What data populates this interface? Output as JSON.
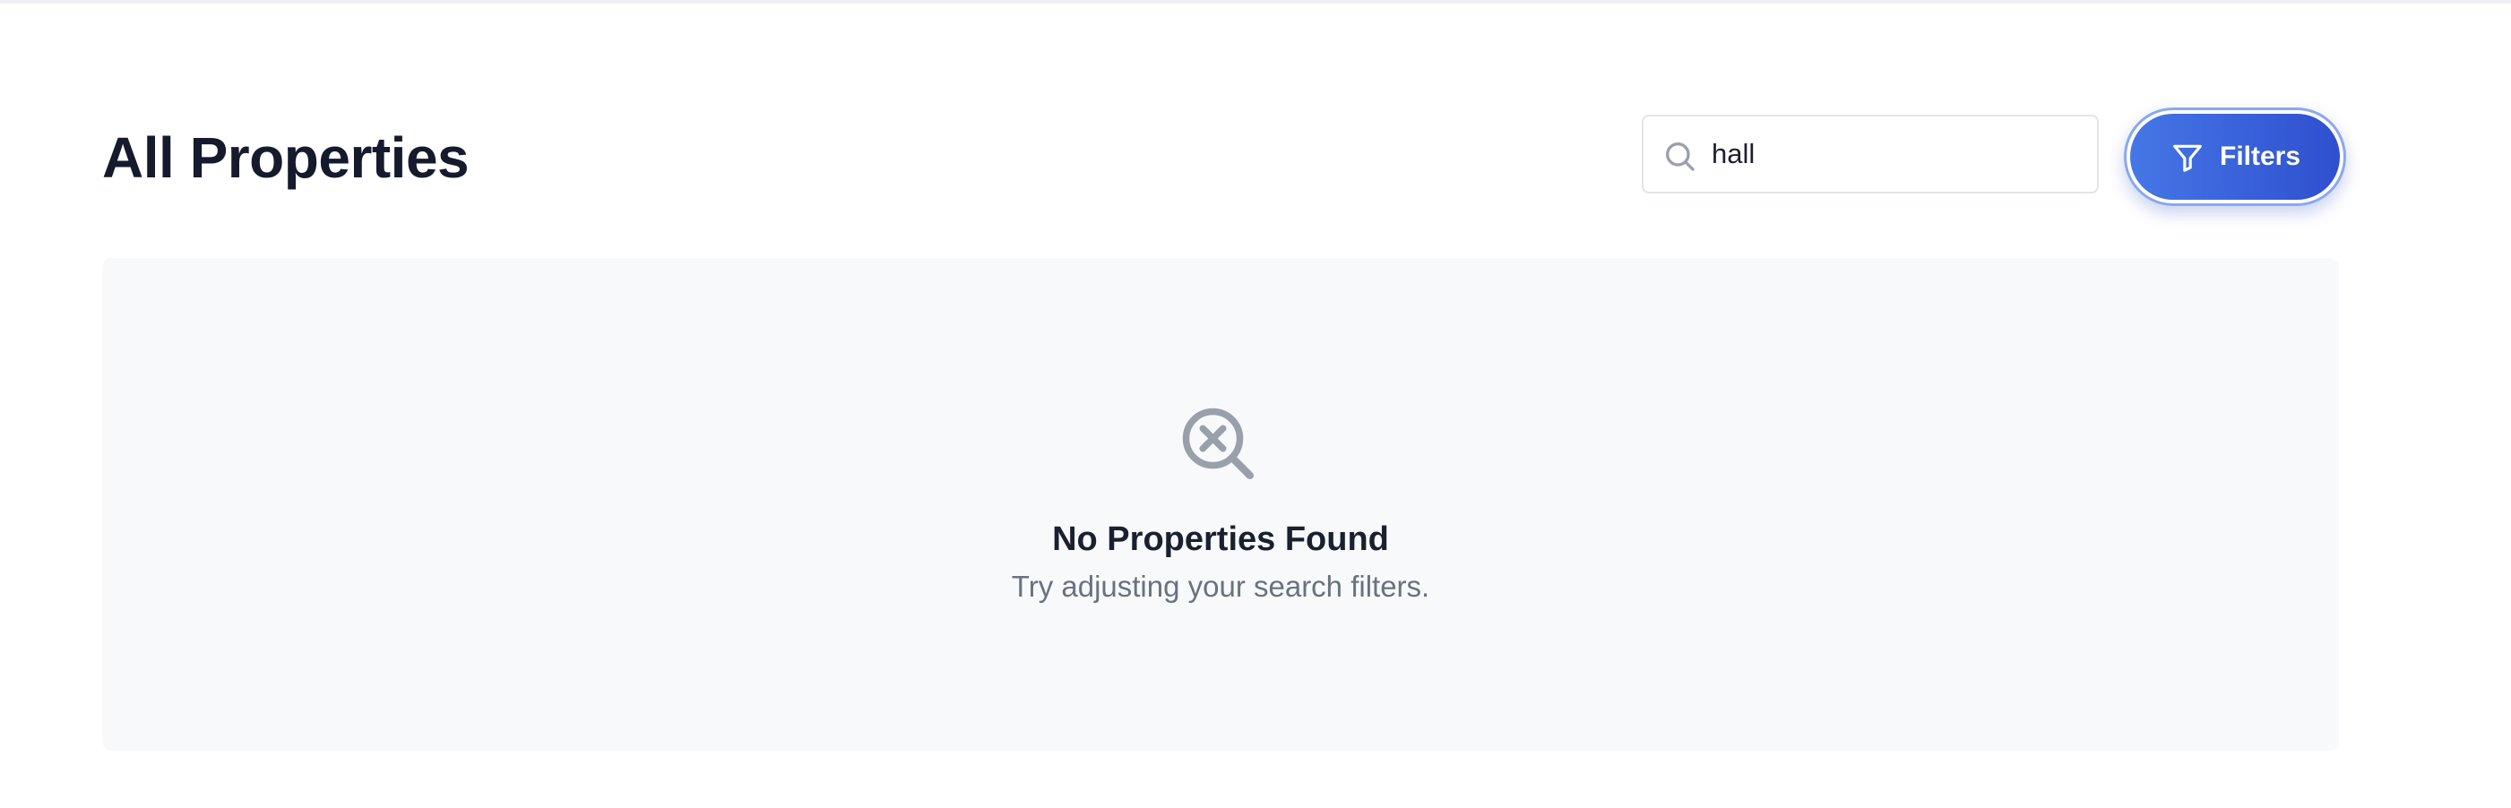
{
  "header": {
    "title": "All Properties"
  },
  "search": {
    "value": "hall",
    "icon": "search-icon"
  },
  "filters": {
    "label": "Filters",
    "icon": "filter-icon",
    "accent_start": "#4577e6",
    "accent_end": "#2f4fcf"
  },
  "empty_state": {
    "icon": "search-no-results-icon",
    "title": "No Properties Found",
    "subtitle": "Try adjusting your search filters."
  }
}
